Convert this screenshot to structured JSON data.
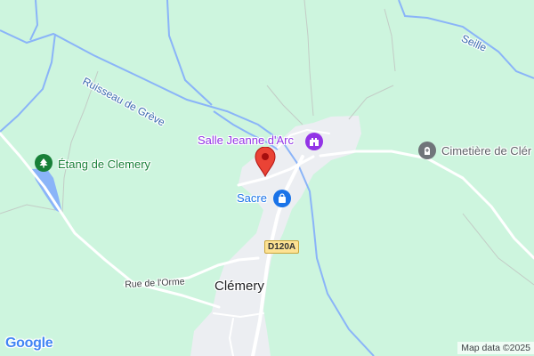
{
  "map": {
    "places": {
      "village": "Clémery",
      "salle": "Salle Jeanne d'Arc",
      "sacre": "Sacre",
      "cemetery": "Cimetière de Clér",
      "pond": "Étang de Clemery"
    },
    "streams": {
      "ruisseau": "Ruisseau de Grève",
      "seille": "Seille"
    },
    "roads": {
      "orme": "Rue de l'Orme",
      "route_shield": "D120A"
    },
    "attribution": "Map data ©2025",
    "logo": "Google",
    "colors": {
      "land": "#cdf5de",
      "water": "#8ab4f8",
      "built_area": "#eceef2",
      "road": "#ffffff",
      "pin": "#ea4335",
      "poi_purple": "#9334e6",
      "poi_blue": "#1a73e8",
      "poi_gray": "#70757a",
      "park_green": "#188038"
    }
  }
}
